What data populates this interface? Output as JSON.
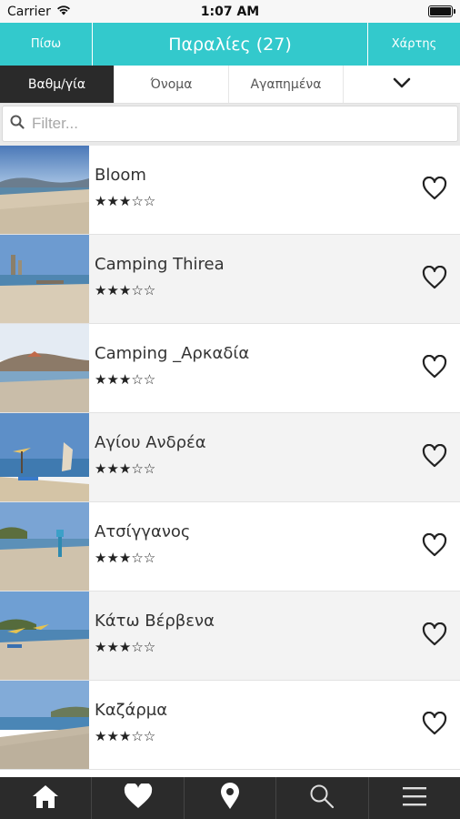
{
  "status_bar": {
    "carrier": "Carrier",
    "time": "1:07 AM"
  },
  "header": {
    "back_label": "Πίσω",
    "title": "Παραλίες (27)",
    "map_label": "Χάρτης",
    "color": "#33c9cc"
  },
  "sort_tabs": [
    {
      "label": "Βαθμ/γία",
      "active": true
    },
    {
      "label": "Όνομα",
      "active": false
    },
    {
      "label": "Αγαπημένα",
      "active": false
    }
  ],
  "search": {
    "placeholder": "Filter...",
    "value": ""
  },
  "beaches": [
    {
      "name": "Bloom",
      "stars": "★★★☆☆",
      "rating": 3
    },
    {
      "name": "Camping Thirea",
      "stars": "★★★☆☆",
      "rating": 3
    },
    {
      "name": "Camping _Αρκαδία",
      "stars": "★★★☆☆",
      "rating": 3
    },
    {
      "name": "Αγίου Ανδρέα",
      "stars": "★★★☆☆",
      "rating": 3
    },
    {
      "name": "Ατσίγγανος",
      "stars": "★★★☆☆",
      "rating": 3
    },
    {
      "name": "Κάτω Βέρβενα",
      "stars": "★★★☆☆",
      "rating": 3
    },
    {
      "name": "Καζάρμα",
      "stars": "★★★☆☆",
      "rating": 3
    }
  ],
  "tab_bar": {
    "icons": [
      "home-icon",
      "heart-icon",
      "location-pin-icon",
      "search-icon",
      "menu-icon"
    ],
    "background": "#2b2b2b"
  }
}
